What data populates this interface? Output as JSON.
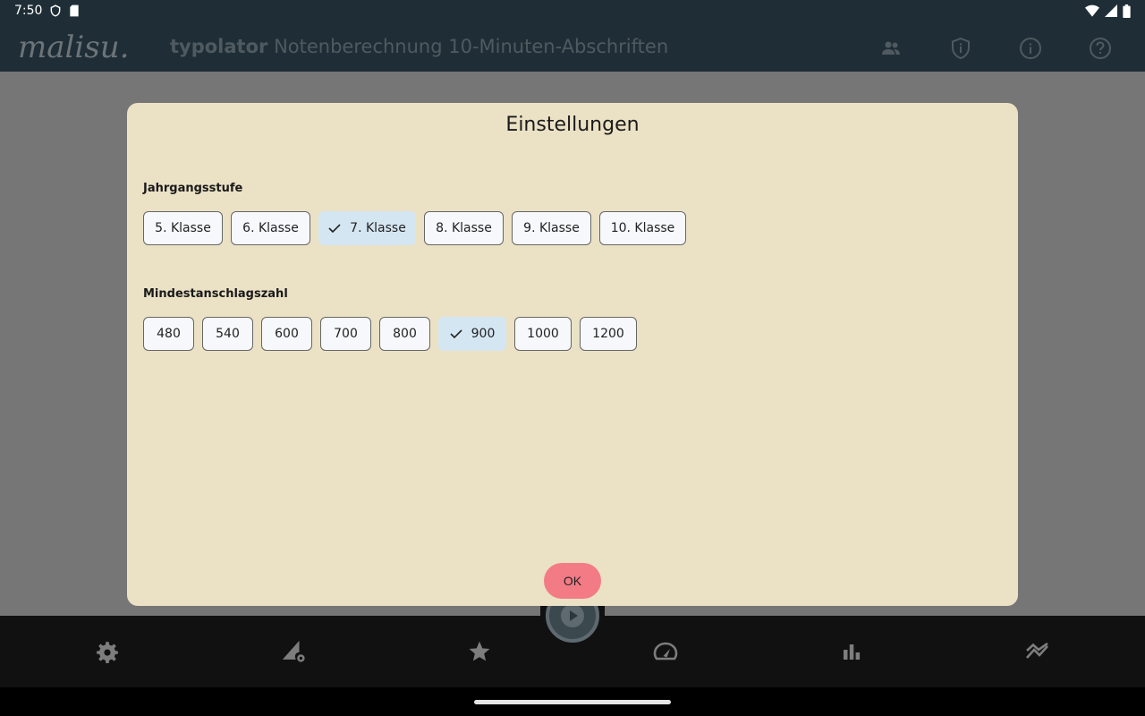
{
  "status_bar": {
    "time": "7:50"
  },
  "app_bar": {
    "logo_text": "malisu.",
    "app_name": "typolator",
    "subtitle": "Notenberechnung 10-Minuten-Abschriften",
    "actions": [
      "people-icon",
      "shield-info-icon",
      "info-icon",
      "help-icon"
    ]
  },
  "dialog": {
    "title": "Einstellungen",
    "grade_section": {
      "label": "Jahrgangsstufe",
      "options": [
        "5. Klasse",
        "6. Klasse",
        "7. Klasse",
        "8. Klasse",
        "9. Klasse",
        "10. Klasse"
      ],
      "selected": "7. Klasse"
    },
    "strokes_section": {
      "label": "Mindestanschlagszahl",
      "options": [
        "480",
        "540",
        "600",
        "700",
        "800",
        "900",
        "1000",
        "1200"
      ],
      "selected": "900"
    },
    "ok_label": "OK"
  },
  "bottom_nav": {
    "items": [
      "settings-icon",
      "signal-settings-icon",
      "star-icon",
      "speedometer-icon",
      "bar-chart-icon",
      "trending-icon"
    ],
    "fab": "play-icon"
  },
  "colors": {
    "app_bar": "#1f2e36",
    "dialog_bg": "#ebe1c5",
    "chip_selected": "#d4e6f2",
    "ok_button": "#f37b86",
    "bottom_nav": "#111111"
  }
}
